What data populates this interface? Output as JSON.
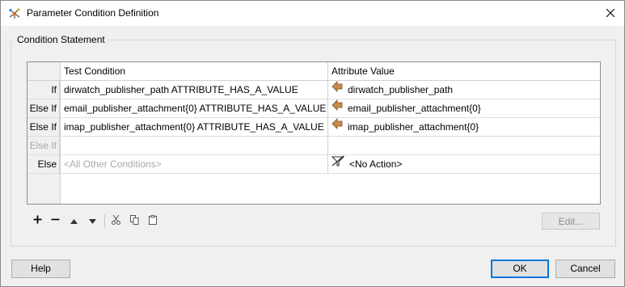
{
  "window": {
    "title": "Parameter Condition Definition"
  },
  "group": {
    "label": "Condition Statement"
  },
  "table": {
    "headers": {
      "test": "Test Condition",
      "value": "Attribute Value"
    },
    "rows": [
      {
        "label": "If",
        "test": "dirwatch_publisher_path ATTRIBUTE_HAS_A_VALUE",
        "value": "dirwatch_publisher_path",
        "icon": "attribute-arrow-icon"
      },
      {
        "label": "Else If",
        "test": "email_publisher_attachment{0} ATTRIBUTE_HAS_A_VALUE",
        "value": "email_publisher_attachment{0}",
        "icon": "attribute-arrow-icon"
      },
      {
        "label": "Else If",
        "test": "imap_publisher_attachment{0} ATTRIBUTE_HAS_A_VALUE",
        "value": "imap_publisher_attachment{0}",
        "icon": "attribute-arrow-icon"
      },
      {
        "label": "Else If",
        "test": "",
        "value": "",
        "icon": ""
      },
      {
        "label": "Else",
        "test": "<All Other Conditions>",
        "value": "<No Action>",
        "icon": "no-action-icon"
      }
    ]
  },
  "toolbar": {
    "edit_label": "Edit..."
  },
  "buttons": {
    "help": "Help",
    "ok": "OK",
    "cancel": "Cancel"
  },
  "colors": {
    "accent": "#0078d7",
    "attribute_icon": "#c98a4b"
  }
}
